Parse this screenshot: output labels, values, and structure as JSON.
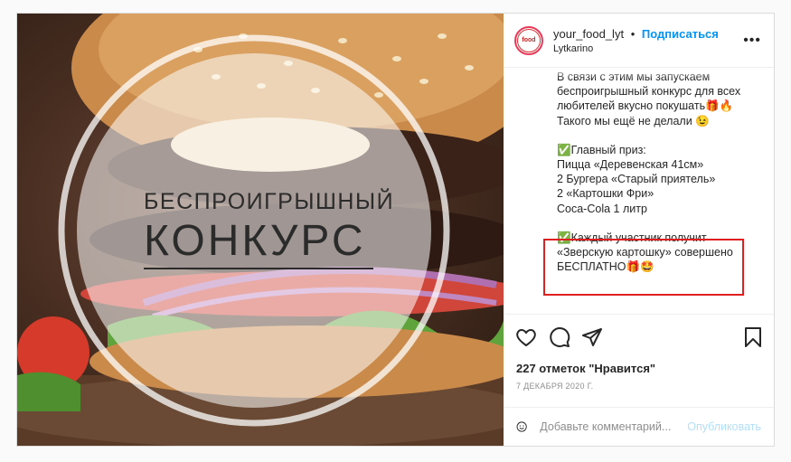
{
  "header": {
    "username": "your_food_lyt",
    "separator": "•",
    "follow_label": "Подписаться",
    "location": "Lytkarino",
    "avatar_text": "food",
    "more_label": "•••"
  },
  "media": {
    "title_line1": "БЕСПРОИГРЫШНЫЙ",
    "title_line2": "КОНКУРС"
  },
  "caption": {
    "p1": "В связи с этим мы запускаем беспроигрышный конкурс для всех любителей вкусно покушать🎁🔥 Такого мы ещё не делали 😉",
    "p2": "✅Главный приз:\nПицца «Деревенская 41см»\n2 Бургера «Старый приятель»\n2 «Картошки Фри»\nCoca-Cola 1 литр",
    "p3": "✅Каждый участник получит «Зверскую картошку» совершено БЕСПЛАТНО🎁🤩"
  },
  "stats": {
    "likes": "227 отметок \"Нравится\"",
    "date": "7 ДЕКАБРЯ 2020 Г."
  },
  "comment": {
    "placeholder": "Добавьте комментарий...",
    "publish_label": "Опубликовать"
  },
  "icons": [
    "heart-icon",
    "comment-icon",
    "share-icon",
    "bookmark-icon",
    "emoji-icon",
    "more-icon"
  ]
}
